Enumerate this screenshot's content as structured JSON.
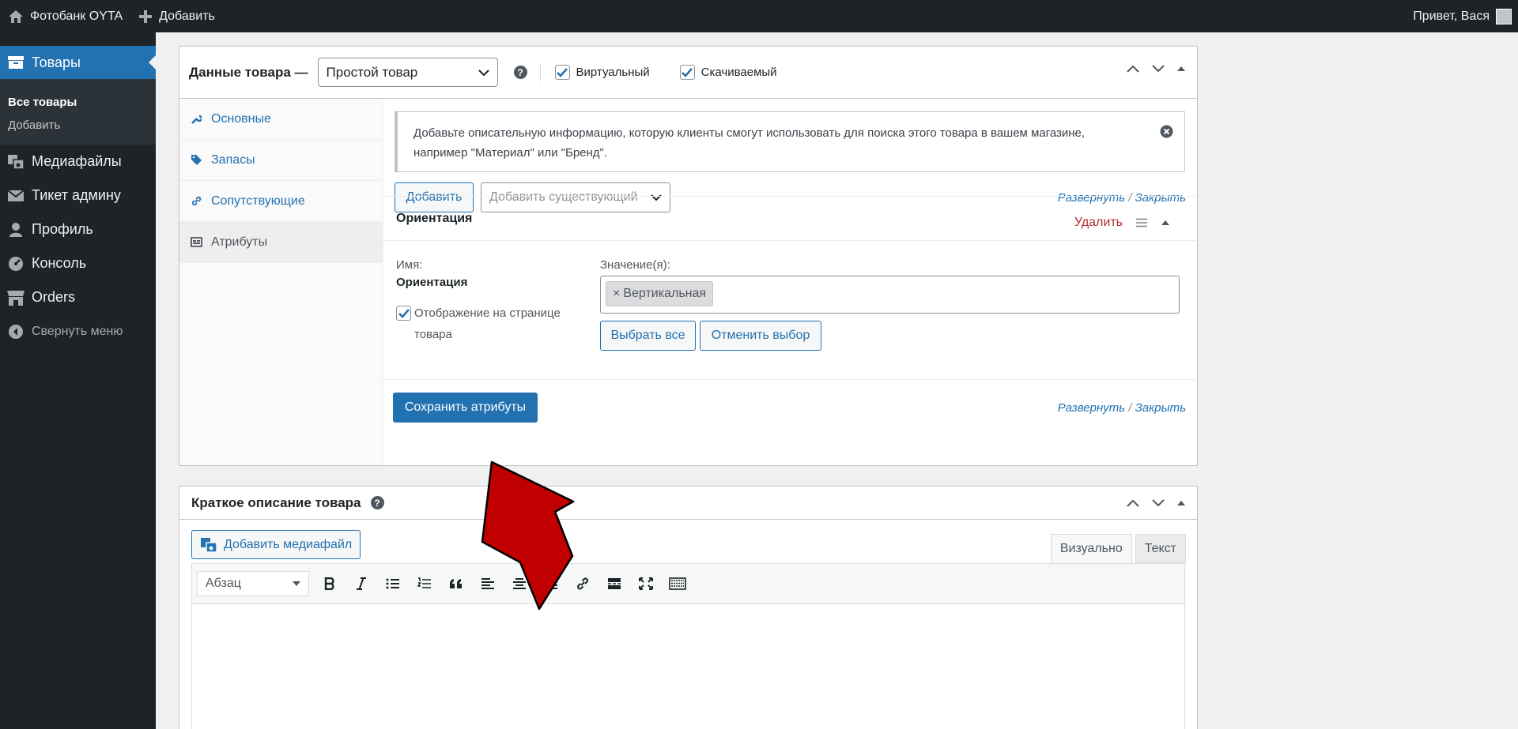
{
  "admin_bar": {
    "site_name": "Фотобанк OYTA",
    "add_new": "Добавить",
    "greeting": "Привет, Вася"
  },
  "sidebar": {
    "current": "Товары",
    "submenu": [
      "Все товары",
      "Добавить"
    ],
    "items": [
      {
        "label": "Медиафайлы",
        "icon": "media-icon"
      },
      {
        "label": "Тикет админу",
        "icon": "mail-icon"
      },
      {
        "label": "Профиль",
        "icon": "user-icon"
      },
      {
        "label": "Консоль",
        "icon": "dashboard-icon"
      },
      {
        "label": "Orders",
        "icon": "store-icon"
      }
    ],
    "collapse": "Свернуть меню"
  },
  "product_data": {
    "title": "Данные товара —",
    "type_select": "Простой товар",
    "virtual_label": "Виртуальный",
    "virtual_checked": true,
    "downloadable_label": "Скачиваемый",
    "downloadable_checked": true,
    "tabs": [
      "Основные",
      "Запасы",
      "Сопутствующие",
      "Атрибуты"
    ],
    "active_tab": "Атрибуты",
    "notice": "Добавьте описательную информацию, которую клиенты смогут использовать для поиска этого товара в вашем магазине, например \"Материал\" или \"Бренд\".",
    "add_button": "Добавить",
    "add_existing_placeholder": "Добавить существующий",
    "expand": "Развернуть",
    "slash": "/",
    "close": "Закрыть",
    "attribute": {
      "name": "Ориентация",
      "delete": "Удалить",
      "name_label": "Имя:",
      "name_value": "Ориентация",
      "visible_label": "Отображение на странице товара",
      "visible_checked": true,
      "values_label": "Значение(я):",
      "values": [
        "Вертикальная"
      ],
      "select_all": "Выбрать все",
      "deselect": "Отменить выбор"
    },
    "save_button": "Сохранить атрибуты"
  },
  "short_description": {
    "title": "Краткое описание товара",
    "add_media": "Добавить медиафайл",
    "tab_visual": "Визуально",
    "tab_text": "Текст",
    "format": "Абзац"
  },
  "colors": {
    "accent": "#2271b1",
    "admin_bg": "#1d2327",
    "arrow": "#c00000",
    "delete": "#b32d2e"
  }
}
